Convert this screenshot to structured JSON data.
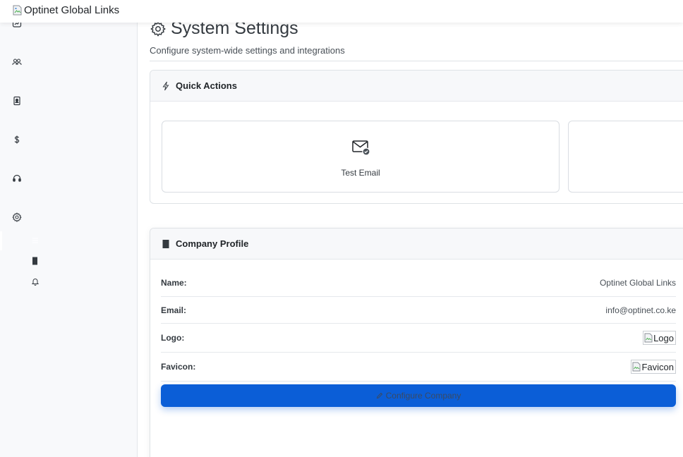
{
  "brand": {
    "alt_text": "Optinet Global Links"
  },
  "sidebar": {
    "icons": [
      "dashboard-icon",
      "users-icon",
      "contacts-icon",
      "dollar-icon",
      "headset-icon",
      "gear-icon"
    ],
    "sub_icons": [
      "list-icon",
      "building-icon",
      "bell-icon"
    ]
  },
  "page": {
    "title": "System Settings",
    "subtitle": "Configure system-wide settings and integrations"
  },
  "quick_actions": {
    "title": "Quick Actions",
    "tiles": [
      {
        "label": "Test Email",
        "icon": "envelope-check-icon"
      },
      {
        "label": "",
        "icon": ""
      }
    ]
  },
  "company_profile": {
    "title": "Company Profile",
    "rows": [
      {
        "label": "Name:",
        "value": "Optinet Global Links"
      },
      {
        "label": "Email:",
        "value": "info@optinet.co.ke"
      },
      {
        "label": "Logo:",
        "value": "Logo"
      },
      {
        "label": "Favicon:",
        "value": "Favicon"
      }
    ],
    "button_label": "Configure Company"
  },
  "colors": {
    "primary": "#0b5ed7",
    "sidebar_bg": "#f8f9fb",
    "card_header_bg": "#f7f8fa"
  }
}
